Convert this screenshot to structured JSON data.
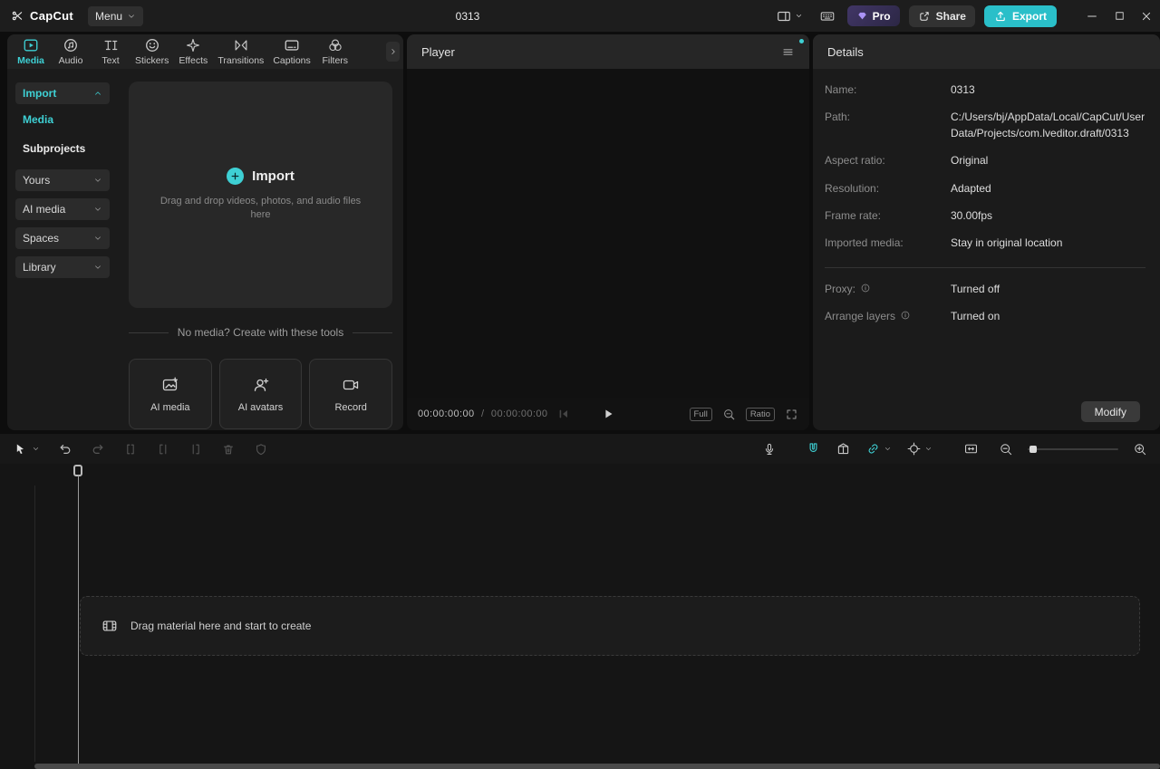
{
  "titlebar": {
    "logo_text": "CapCut",
    "menu_label": "Menu",
    "project_title": "0313",
    "pro_label": "Pro",
    "share_label": "Share",
    "export_label": "Export"
  },
  "media_panel": {
    "tabs": [
      {
        "label": "Media"
      },
      {
        "label": "Audio"
      },
      {
        "label": "Text"
      },
      {
        "label": "Stickers"
      },
      {
        "label": "Effects"
      },
      {
        "label": "Transitions"
      },
      {
        "label": "Captions"
      },
      {
        "label": "Filters"
      }
    ],
    "sidebar": {
      "import_label": "Import",
      "media_label": "Media",
      "subprojects_label": "Subprojects",
      "groups": [
        {
          "label": "Yours"
        },
        {
          "label": "AI media"
        },
        {
          "label": "Spaces"
        },
        {
          "label": "Library"
        }
      ]
    },
    "dropzone": {
      "title": "Import",
      "subtitle": "Drag and drop videos, photos, and audio files here"
    },
    "tools_divider": "No media? Create with these tools",
    "tools": [
      {
        "label": "AI media"
      },
      {
        "label": "AI avatars"
      },
      {
        "label": "Record"
      }
    ]
  },
  "player": {
    "title": "Player",
    "time_current": "00:00:00:00",
    "time_separator": "/",
    "time_total": "00:00:00:00",
    "full_label": "Full",
    "ratio_label": "Ratio"
  },
  "details": {
    "title": "Details",
    "rows": [
      {
        "label": "Name:",
        "value": "0313"
      },
      {
        "label": "Path:",
        "value": "C:/Users/bj/AppData/Local/CapCut/User Data/Projects/com.lveditor.draft/0313"
      },
      {
        "label": "Aspect ratio:",
        "value": "Original"
      },
      {
        "label": "Resolution:",
        "value": "Adapted"
      },
      {
        "label": "Frame rate:",
        "value": "30.00fps"
      },
      {
        "label": "Imported media:",
        "value": "Stay in original location"
      }
    ],
    "proxy_label": "Proxy:",
    "proxy_value": "Turned off",
    "arrange_label": "Arrange layers",
    "arrange_value": "Turned on",
    "modify_label": "Modify"
  },
  "timeline": {
    "empty_text": "Drag material here and start to create"
  },
  "colors": {
    "accent_cyan": "#3ed0d4",
    "export_button": "#2abfc9",
    "pro_gem": "#ab93f7"
  }
}
